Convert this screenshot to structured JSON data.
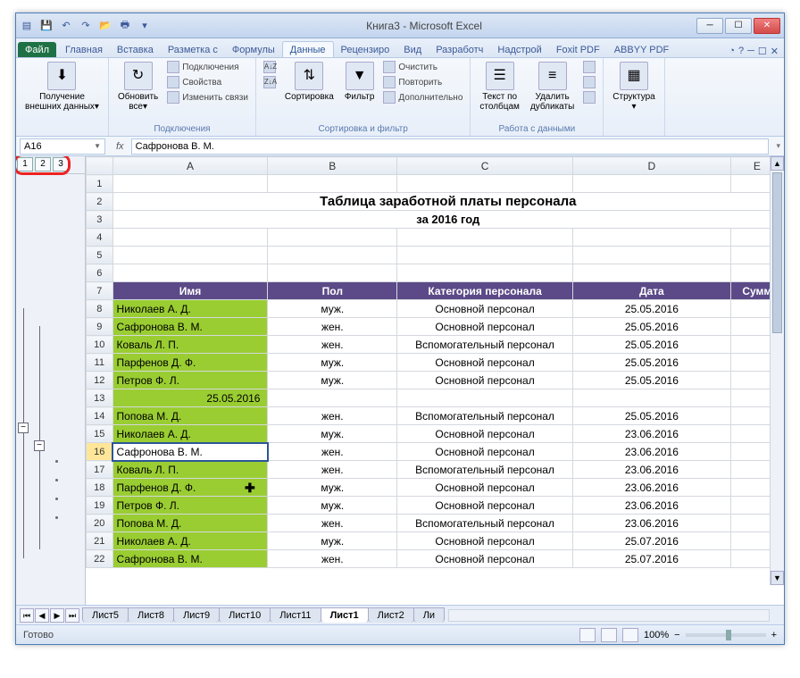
{
  "window": {
    "title": "Книга3 - Microsoft Excel"
  },
  "qat": [
    "excel",
    "save",
    "undo",
    "redo",
    "open",
    "print",
    "quick"
  ],
  "wincontrols": {
    "min": "─",
    "max": "☐",
    "close": "✕"
  },
  "ribbon": {
    "file": "Файл",
    "tabs": [
      "Главная",
      "Вставка",
      "Разметка с",
      "Формулы",
      "Данные",
      "Рецензиро",
      "Вид",
      "Разработч",
      "Надстрой",
      "Foxit PDF",
      "ABBYY PDF"
    ],
    "active": "Данные",
    "help_icons": [
      "◔",
      "?",
      "─",
      "☐",
      "✕"
    ],
    "groups": {
      "g1": {
        "label": "",
        "btn": "Получение\nвнешних данных▾",
        "icon": "⬇"
      },
      "g2": {
        "label": "Подключения",
        "btn": "Обновить\nвсе▾",
        "icon": "↻",
        "items": [
          "Подключения",
          "Свойства",
          "Изменить связи"
        ]
      },
      "g3": {
        "label": "Сортировка и фильтр",
        "btn1": "Сортировка",
        "btn2": "Фильтр",
        "icons": [
          "A↓Z",
          "Z↓A"
        ],
        "items": [
          "Очистить",
          "Повторить",
          "Дополнительно"
        ]
      },
      "g4": {
        "label": "Работа с данными",
        "btn1": "Текст по\nстолбцам",
        "btn2": "Удалить\nдубликаты"
      },
      "g5": {
        "label": "",
        "btn": "Структура\n▾",
        "icon": "▦"
      }
    }
  },
  "formula": {
    "name_box": "A16",
    "fx": "fx",
    "value": "Сафронова В. М."
  },
  "outline": {
    "levels": [
      "1",
      "2",
      "3"
    ]
  },
  "columns": [
    "A",
    "B",
    "C",
    "D",
    "E"
  ],
  "title": "Таблица заработной платы персонала",
  "subtitle": "за 2016 год",
  "headers": [
    "Имя",
    "Пол",
    "Категория персонала",
    "Дата",
    "Сумм"
  ],
  "rows": [
    {
      "n": 8,
      "name": "Николаев А. Д.",
      "sex": "муж.",
      "cat": "Основной персонал",
      "date": "25.05.2016"
    },
    {
      "n": 9,
      "name": "Сафронова В. М.",
      "sex": "жен.",
      "cat": "Основной персонал",
      "date": "25.05.2016"
    },
    {
      "n": 10,
      "name": "Коваль Л. П.",
      "sex": "жен.",
      "cat": "Вспомогательный персонал",
      "date": "25.05.2016"
    },
    {
      "n": 11,
      "name": "Парфенов Д. Ф.",
      "sex": "муж.",
      "cat": "Основной персонал",
      "date": "25.05.2016"
    },
    {
      "n": 12,
      "name": "Петров Ф. Л.",
      "sex": "муж.",
      "cat": "Основной персонал",
      "date": "25.05.2016"
    },
    {
      "n": 13,
      "subtotal": "25.05.2016"
    },
    {
      "n": 14,
      "name": "Попова М. Д.",
      "sex": "жен.",
      "cat": "Вспомогательный персонал",
      "date": "25.05.2016"
    },
    {
      "n": 15,
      "name": "Николаев А. Д.",
      "sex": "муж.",
      "cat": "Основной персонал",
      "date": "23.06.2016"
    },
    {
      "n": 16,
      "name": "Сафронова В. М.",
      "sex": "жен.",
      "cat": "Основной персонал",
      "date": "23.06.2016",
      "selected": true
    },
    {
      "n": 17,
      "name": "Коваль Л. П.",
      "sex": "жен.",
      "cat": "Вспомогательный персонал",
      "date": "23.06.2016"
    },
    {
      "n": 18,
      "name": "Парфенов Д. Ф.",
      "sex": "муж.",
      "cat": "Основной персонал",
      "date": "23.06.2016",
      "cursor": true
    },
    {
      "n": 19,
      "name": "Петров Ф. Л.",
      "sex": "муж.",
      "cat": "Основной персонал",
      "date": "23.06.2016"
    },
    {
      "n": 20,
      "name": "Попова М. Д.",
      "sex": "жен.",
      "cat": "Вспомогательный персонал",
      "date": "23.06.2016"
    },
    {
      "n": 21,
      "name": "Николаев А. Д.",
      "sex": "муж.",
      "cat": "Основной персонал",
      "date": "25.07.2016"
    },
    {
      "n": 22,
      "name": "Сафронова В. М.",
      "sex": "жен.",
      "cat": "Основной персонал",
      "date": "25.07.2016"
    }
  ],
  "sheets": [
    "Лист5",
    "Лист8",
    "Лист9",
    "Лист10",
    "Лист11",
    "Лист1",
    "Лист2",
    "Ли"
  ],
  "active_sheet": "Лист1",
  "tab_nav": [
    "⏮",
    "◀",
    "▶",
    "⏭"
  ],
  "status": {
    "ready": "Готово",
    "zoom": "100%",
    "minus": "−",
    "plus": "+"
  }
}
